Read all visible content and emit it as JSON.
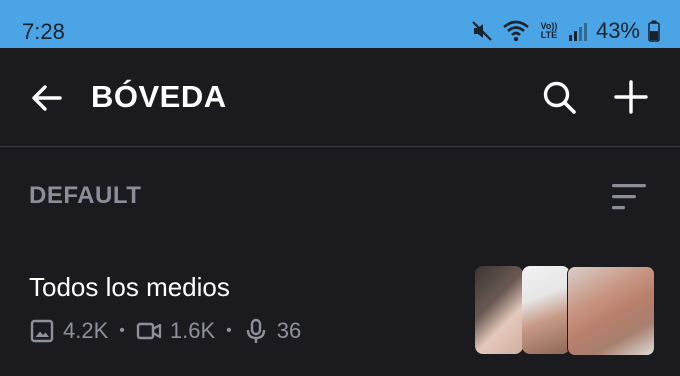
{
  "status_bar": {
    "time": "7:28",
    "battery_percent": "43%",
    "network_label_top": "Vo))",
    "network_label_bottom": "LTE",
    "icons": [
      "mute-icon",
      "wifi-icon",
      "volte-lte-icon",
      "signal-icon",
      "battery-icon"
    ]
  },
  "app_bar": {
    "title": "BÓVEDA",
    "icons": [
      "back-arrow-icon",
      "search-icon",
      "add-icon"
    ]
  },
  "section": {
    "title": "DEFAULT",
    "icon": "sort-icon"
  },
  "item": {
    "title": "Todos los medios",
    "images_count": "4.2K",
    "videos_count": "1.6K",
    "audio_count": "36",
    "separator": "•"
  },
  "colors": {
    "status_bar_bg": "#4aa4e6",
    "background": "#1b1b1f",
    "secondary_text": "#8b8d98",
    "divider": "#3c3c44"
  }
}
